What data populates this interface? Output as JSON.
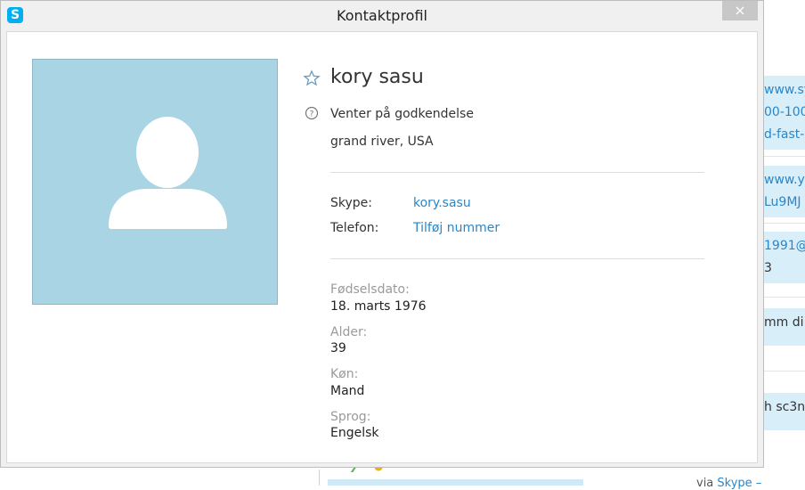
{
  "background": {
    "bubbles": [
      {
        "lines": [
          "www.syt",
          "00-100",
          "d-fast-"
        ],
        "kind": "link"
      },
      {
        "lines": [
          "www.yo",
          "Lu9MJ"
        ],
        "kind": "link"
      },
      {
        "lines": [
          "1991@",
          "3"
        ],
        "kind": "mixed"
      },
      {
        "lines": [
          "mm di"
        ],
        "kind": "plain"
      },
      {
        "lines": [
          "h sc3n"
        ],
        "kind": "plain"
      }
    ],
    "footer_prefix": "via",
    "footer_link": "Skype –"
  },
  "dialog": {
    "title": "Kontaktprofil",
    "close_label": "×",
    "app_icon_letter": "S",
    "contact": {
      "name": "kory sasu",
      "status": "Venter på godkendelse",
      "location": "grand river, USA"
    },
    "rows": [
      {
        "label": "Skype:",
        "value": "kory.sasu"
      },
      {
        "label": "Telefon:",
        "value": "Tilføj nummer"
      }
    ],
    "fields": [
      {
        "label": "Fødselsdato:",
        "value": "18. marts 1976"
      },
      {
        "label": "Alder:",
        "value": "39"
      },
      {
        "label": "Køn:",
        "value": "Mand"
      },
      {
        "label": "Sprog:",
        "value": "Engelsk"
      }
    ]
  },
  "colors": {
    "accent": "#2a86c8",
    "avatar_bg": "#a9d4e3",
    "skype_blue": "#00aff0"
  },
  "icons": {
    "app": "skype-icon",
    "favorite": "star-icon",
    "status": "question-icon",
    "close": "close-icon",
    "avatar": "person-icon"
  }
}
